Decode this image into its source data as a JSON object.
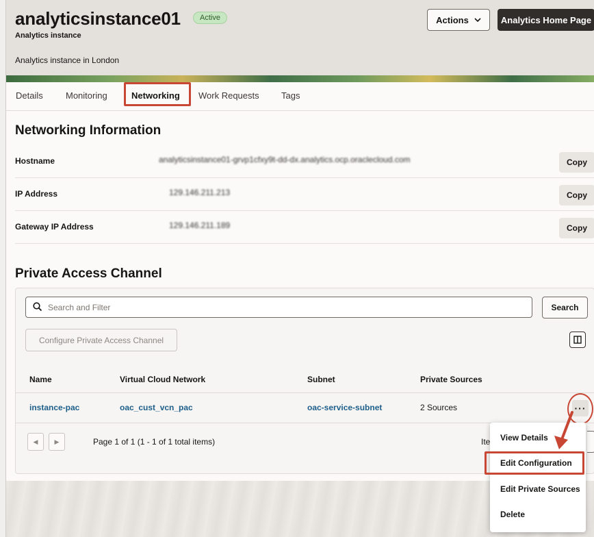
{
  "header": {
    "title": "analyticsinstance01",
    "status_badge": "Active",
    "subtitle": "Analytics instance",
    "description": "Analytics instance in London",
    "actions_label": "Actions",
    "home_button_label": "Analytics Home Page"
  },
  "tabs": [
    {
      "label": "Details"
    },
    {
      "label": "Monitoring"
    },
    {
      "label": "Networking",
      "active": true
    },
    {
      "label": "Work Requests"
    },
    {
      "label": "Tags"
    }
  ],
  "networking": {
    "title": "Networking Information",
    "rows": [
      {
        "label": "Hostname",
        "value": "analyticsinstance01-grvp1cfxy9t-dd-dx.analytics.ocp.oraclecloud.com",
        "copy_label": "Copy"
      },
      {
        "label": "IP Address",
        "value": "129.146.211.213",
        "copy_label": "Copy"
      },
      {
        "label": "Gateway IP Address",
        "value": "129.146.211.189",
        "copy_label": "Copy"
      }
    ]
  },
  "pac": {
    "title": "Private Access Channel",
    "search_placeholder": "Search and Filter",
    "search_button": "Search",
    "configure_button": "Configure Private Access Channel",
    "columns": [
      "Name",
      "Virtual Cloud Network",
      "Subnet",
      "Private Sources"
    ],
    "rows": [
      {
        "name": "instance-pac",
        "vcn": "oac_cust_vcn_pac",
        "subnet": "oac-service-subnet",
        "sources": "2 Sources"
      }
    ],
    "pager_text": "Page 1 of 1 (1 - 1 of 1 total items)",
    "items_label": "Items"
  },
  "menu": {
    "items": [
      "View Details",
      "Edit Configuration",
      "Edit Private Sources",
      "Delete"
    ],
    "highlighted": "Edit Configuration"
  },
  "colors": {
    "highlight": "#c74634",
    "link": "#1d5f8a",
    "primary_button": "#312d2a",
    "badge_bg": "#c7e6c2"
  }
}
